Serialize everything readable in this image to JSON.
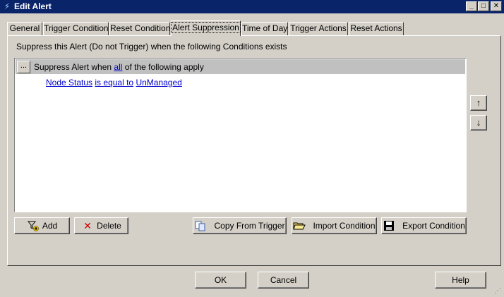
{
  "window": {
    "title": "Edit Alert",
    "controls": {
      "minimize": "_",
      "maximize": "□",
      "close": "✕"
    }
  },
  "tabs": [
    {
      "label": "General",
      "active": false
    },
    {
      "label": "Trigger Condition",
      "active": false
    },
    {
      "label": "Reset Condition",
      "active": false
    },
    {
      "label": "Alert Suppression",
      "active": true
    },
    {
      "label": "Time of Day",
      "active": false
    },
    {
      "label": "Trigger Actions",
      "active": false
    },
    {
      "label": "Reset Actions",
      "active": false
    }
  ],
  "panel": {
    "instructions": "Suppress this Alert (Do not Trigger) when the following Conditions exists",
    "condition": {
      "dots_label": "...",
      "header_prefix": "Suppress Alert when",
      "header_quantifier": "all",
      "header_suffix": "of the following apply",
      "rule": {
        "field": "Node Status",
        "operator": "is equal to",
        "value": "UnManaged"
      }
    },
    "move_up": "↑",
    "move_down": "↓",
    "buttons": {
      "add": "Add",
      "delete": "Delete",
      "copy_from_trigger": "Copy From Trigger",
      "import_condition": "Import Condition",
      "export_condition": "Export Condition"
    }
  },
  "footer": {
    "ok": "OK",
    "cancel": "Cancel",
    "help": "Help"
  },
  "icons": {
    "app": "alert-icon",
    "add": "add-condition-icon",
    "delete": "delete-x-icon",
    "copy": "copy-icon",
    "import": "folder-open-icon",
    "export": "floppy-disk-icon"
  },
  "colors": {
    "titlebar": "#0a246a",
    "link": "#0000cc",
    "delete_icon": "#cc0000"
  }
}
